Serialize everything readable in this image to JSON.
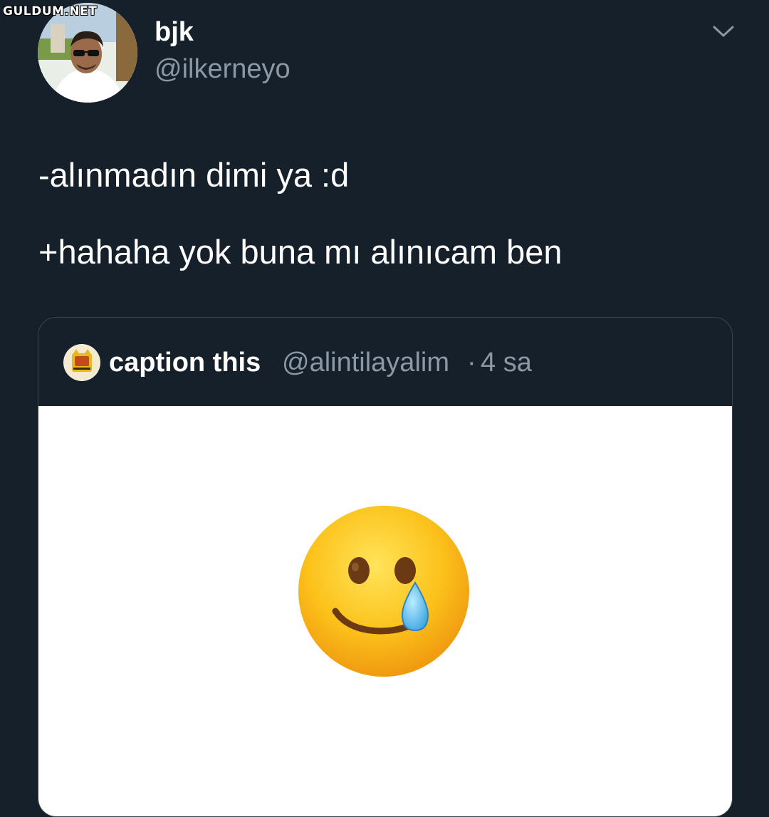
{
  "watermark": "GULDUM.NET",
  "author": {
    "display_name": "bjk",
    "handle": "@ilkerneyo",
    "avatar_icon": "profile-photo",
    "menu_icon": "chevron-down-icon"
  },
  "tweet": {
    "lines": [
      "-alınmadın dimi ya :d",
      "+hahaha yok buna mı alınıcam ben"
    ]
  },
  "quoted_tweet": {
    "display_name": "caption this",
    "handle": "@alintilayalim",
    "separator": "·",
    "time": "4 sa",
    "avatar_icon": "caption-this-logo",
    "media_icon": "smiling-face-with-tear-emoji"
  },
  "colors": {
    "background": "#16202b",
    "secondary_text": "#8b98a5",
    "border": "#38444d"
  }
}
